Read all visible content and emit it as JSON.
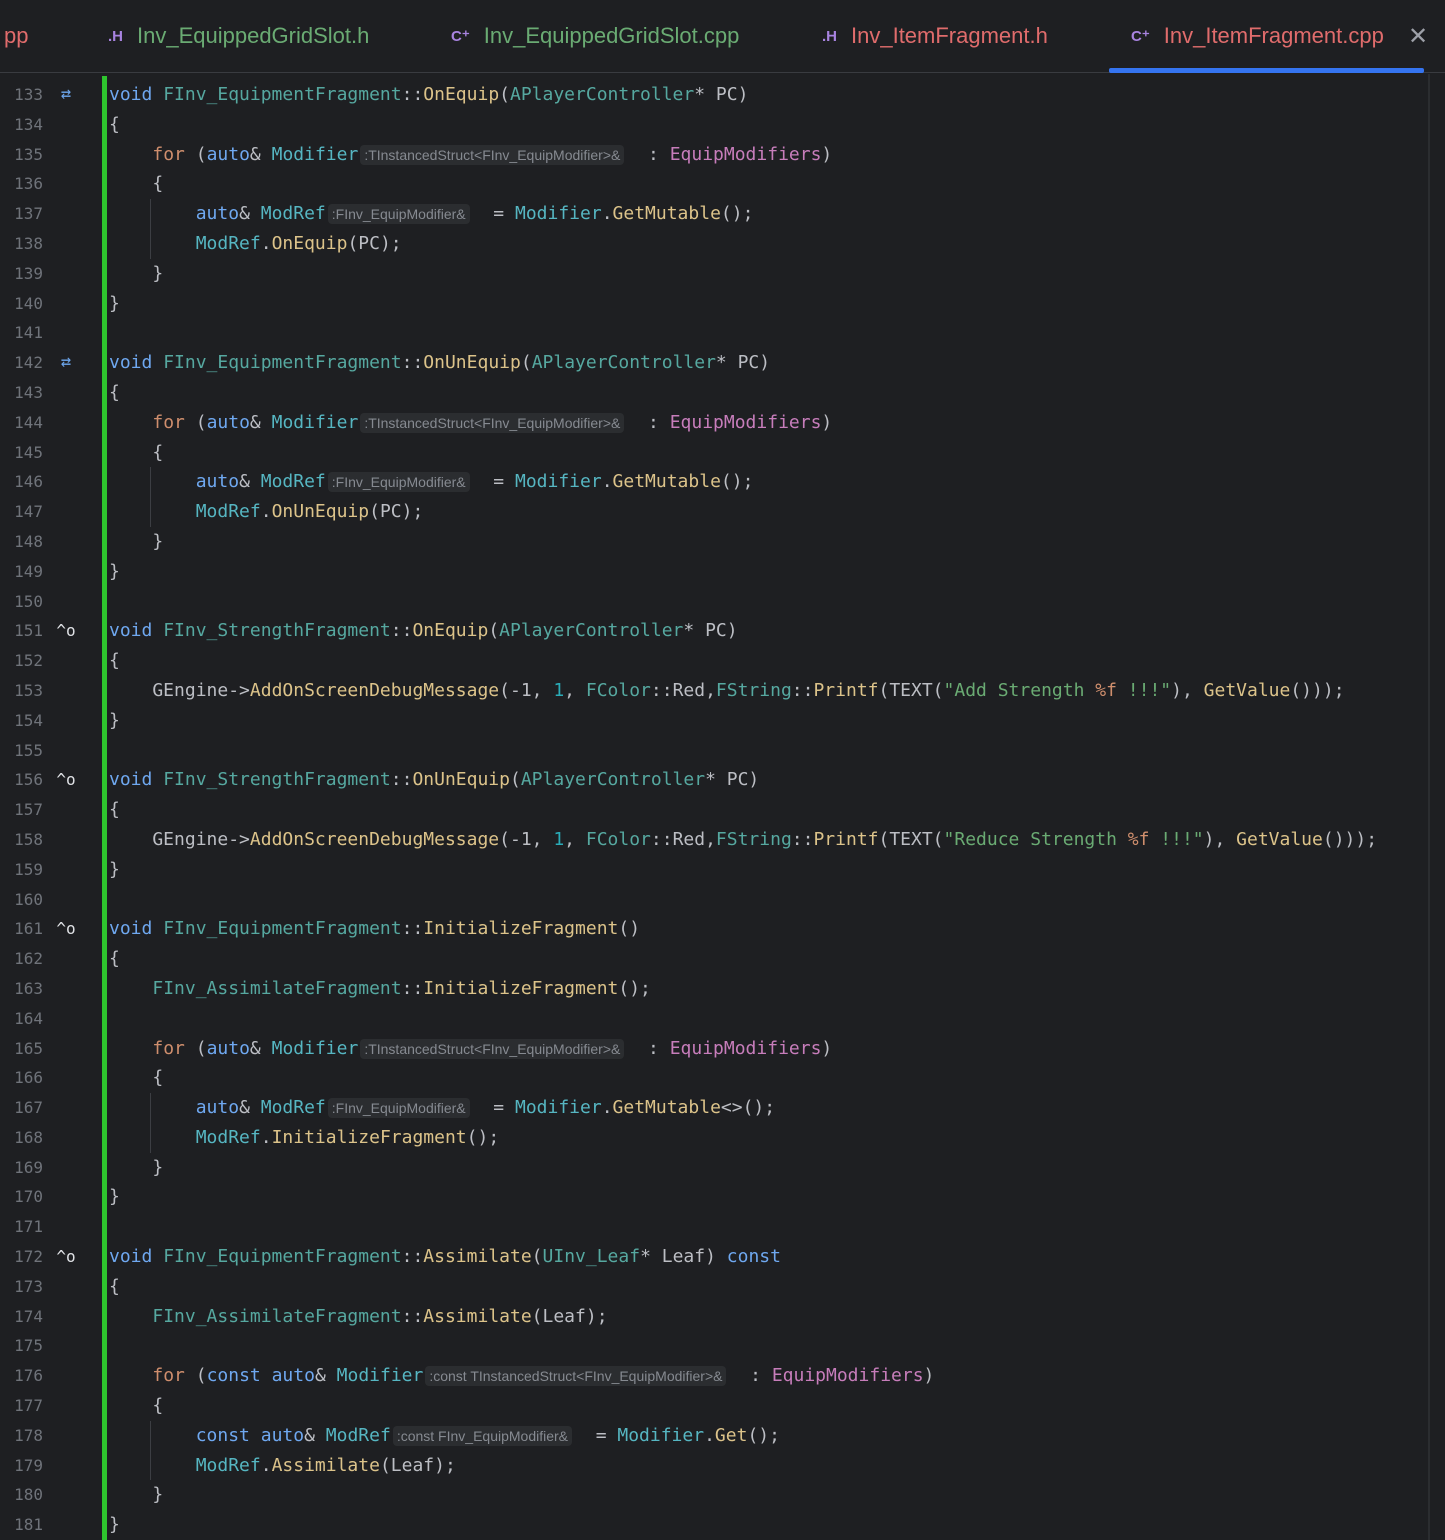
{
  "tabs": [
    {
      "type": "",
      "name": "pp",
      "color": "#e06c6c",
      "left": 0
    },
    {
      "type": ".H",
      "name": "Inv_EquippedGridSlot.h",
      "color": "#6aab73",
      "typecolor": "#a883e0"
    },
    {
      "type": "C⁺",
      "name": "Inv_EquippedGridSlot.cpp",
      "color": "#6aab73",
      "typecolor": "#a883e0"
    },
    {
      "type": ".H",
      "name": "Inv_ItemFragment.h",
      "color": "#e06c6c",
      "typecolor": "#a883e0"
    },
    {
      "type": "C⁺",
      "name": "Inv_ItemFragment.cpp",
      "color": "#e06c6c",
      "typecolor": "#a883e0",
      "active": true
    }
  ],
  "close_label": "✕",
  "lines": [
    {
      "n": "133",
      "icon": "⇄",
      "code": [
        [
          "k2",
          "void "
        ],
        [
          "cls",
          "FInv_EquipmentFragment"
        ],
        [
          "",
          "::"
        ],
        [
          "fn",
          "OnEquip"
        ],
        [
          "",
          "("
        ],
        [
          "cls",
          "APlayerController"
        ],
        [
          "",
          "* PC)"
        ]
      ]
    },
    {
      "n": "134",
      "code": [
        [
          "",
          "{"
        ]
      ]
    },
    {
      "n": "135",
      "code": [
        [
          "",
          "    "
        ],
        [
          "kw",
          "for "
        ],
        [
          "",
          "("
        ],
        [
          "k2",
          "auto"
        ],
        [
          "",
          "& "
        ],
        [
          "fn2",
          "Modifier"
        ],
        [
          "hint",
          ":TInstancedStruct<FInv_EquipModifier>&"
        ],
        [
          "",
          "  : "
        ],
        [
          "mem",
          "EquipModifiers"
        ],
        [
          "",
          ")"
        ]
      ]
    },
    {
      "n": "136",
      "code": [
        [
          "",
          "    {"
        ]
      ]
    },
    {
      "n": "137",
      "guide": true,
      "code": [
        [
          "",
          "        "
        ],
        [
          "k2",
          "auto"
        ],
        [
          "",
          "& "
        ],
        [
          "fn2",
          "ModRef"
        ],
        [
          "hint",
          ":FInv_EquipModifier&"
        ],
        [
          "",
          "  = "
        ],
        [
          "fn2",
          "Modifier"
        ],
        [
          "",
          "."
        ],
        [
          "fn",
          "GetMutable"
        ],
        [
          "",
          "();"
        ]
      ]
    },
    {
      "n": "138",
      "guide": true,
      "code": [
        [
          "",
          "        "
        ],
        [
          "fn2",
          "ModRef"
        ],
        [
          "",
          "."
        ],
        [
          "fn",
          "OnEquip"
        ],
        [
          "",
          "(PC);"
        ]
      ]
    },
    {
      "n": "139",
      "code": [
        [
          "",
          "    }"
        ]
      ]
    },
    {
      "n": "140",
      "code": [
        [
          "",
          "}"
        ]
      ]
    },
    {
      "n": "141",
      "code": []
    },
    {
      "n": "142",
      "icon": "⇄",
      "code": [
        [
          "k2",
          "void "
        ],
        [
          "cls",
          "FInv_EquipmentFragment"
        ],
        [
          "",
          "::"
        ],
        [
          "fn",
          "OnUnEquip"
        ],
        [
          "",
          "("
        ],
        [
          "cls",
          "APlayerController"
        ],
        [
          "",
          "* PC)"
        ]
      ]
    },
    {
      "n": "143",
      "code": [
        [
          "",
          "{"
        ]
      ]
    },
    {
      "n": "144",
      "code": [
        [
          "",
          "    "
        ],
        [
          "kw",
          "for "
        ],
        [
          "",
          "("
        ],
        [
          "k2",
          "auto"
        ],
        [
          "",
          "& "
        ],
        [
          "fn2",
          "Modifier"
        ],
        [
          "hint",
          ":TInstancedStruct<FInv_EquipModifier>&"
        ],
        [
          "",
          "  : "
        ],
        [
          "mem",
          "EquipModifiers"
        ],
        [
          "",
          ")"
        ]
      ]
    },
    {
      "n": "145",
      "code": [
        [
          "",
          "    {"
        ]
      ]
    },
    {
      "n": "146",
      "guide": true,
      "code": [
        [
          "",
          "        "
        ],
        [
          "k2",
          "auto"
        ],
        [
          "",
          "& "
        ],
        [
          "fn2",
          "ModRef"
        ],
        [
          "hint",
          ":FInv_EquipModifier&"
        ],
        [
          "",
          "  = "
        ],
        [
          "fn2",
          "Modifier"
        ],
        [
          "",
          "."
        ],
        [
          "fn",
          "GetMutable"
        ],
        [
          "",
          "();"
        ]
      ]
    },
    {
      "n": "147",
      "guide": true,
      "code": [
        [
          "",
          "        "
        ],
        [
          "fn2",
          "ModRef"
        ],
        [
          "",
          "."
        ],
        [
          "fn",
          "OnUnEquip"
        ],
        [
          "",
          "(PC);"
        ]
      ]
    },
    {
      "n": "148",
      "code": [
        [
          "",
          "    }"
        ]
      ]
    },
    {
      "n": "149",
      "code": [
        [
          "",
          "}"
        ]
      ]
    },
    {
      "n": "150",
      "code": []
    },
    {
      "n": "151",
      "icon": "^o",
      "impl": true,
      "code": [
        [
          "k2",
          "void "
        ],
        [
          "cls",
          "FInv_StrengthFragment"
        ],
        [
          "",
          "::"
        ],
        [
          "fn",
          "OnEquip"
        ],
        [
          "",
          "("
        ],
        [
          "cls",
          "APlayerController"
        ],
        [
          "",
          "* PC)"
        ]
      ]
    },
    {
      "n": "152",
      "code": [
        [
          "",
          "{"
        ]
      ]
    },
    {
      "n": "153",
      "code": [
        [
          "",
          "    GEngine->"
        ],
        [
          "fn",
          "AddOnScreenDebugMessage"
        ],
        [
          "",
          "(-1, "
        ],
        [
          "num",
          "1"
        ],
        [
          "",
          ", "
        ],
        [
          "cls",
          "FColor"
        ],
        [
          "",
          "::Red,"
        ],
        [
          "cls",
          "FString"
        ],
        [
          "",
          "::"
        ],
        [
          "fn",
          "Printf"
        ],
        [
          "",
          "(TEXT("
        ],
        [
          "str",
          "\"Add Strength "
        ],
        [
          "fmt",
          "%f"
        ],
        [
          "str",
          " !!!\""
        ],
        [
          "",
          "), "
        ],
        [
          "fn",
          "GetValue"
        ],
        [
          "",
          "()));"
        ]
      ]
    },
    {
      "n": "154",
      "code": [
        [
          "",
          "}"
        ]
      ]
    },
    {
      "n": "155",
      "code": []
    },
    {
      "n": "156",
      "icon": "^o",
      "impl": true,
      "code": [
        [
          "k2",
          "void "
        ],
        [
          "cls",
          "FInv_StrengthFragment"
        ],
        [
          "",
          "::"
        ],
        [
          "fn",
          "OnUnEquip"
        ],
        [
          "",
          "("
        ],
        [
          "cls",
          "APlayerController"
        ],
        [
          "",
          "* PC)"
        ]
      ]
    },
    {
      "n": "157",
      "code": [
        [
          "",
          "{"
        ]
      ]
    },
    {
      "n": "158",
      "code": [
        [
          "",
          "    GEngine->"
        ],
        [
          "fn",
          "AddOnScreenDebugMessage"
        ],
        [
          "",
          "(-1, "
        ],
        [
          "num",
          "1"
        ],
        [
          "",
          ", "
        ],
        [
          "cls",
          "FColor"
        ],
        [
          "",
          "::Red,"
        ],
        [
          "cls",
          "FString"
        ],
        [
          "",
          "::"
        ],
        [
          "fn",
          "Printf"
        ],
        [
          "",
          "(TEXT("
        ],
        [
          "str",
          "\"Reduce Strength "
        ],
        [
          "fmt",
          "%f"
        ],
        [
          "str",
          " !!!\""
        ],
        [
          "",
          "), "
        ],
        [
          "fn",
          "GetValue"
        ],
        [
          "",
          "()));"
        ]
      ]
    },
    {
      "n": "159",
      "code": [
        [
          "",
          "}"
        ]
      ]
    },
    {
      "n": "160",
      "code": []
    },
    {
      "n": "161",
      "icon": "^o",
      "impl": true,
      "code": [
        [
          "k2",
          "void "
        ],
        [
          "cls",
          "FInv_EquipmentFragment"
        ],
        [
          "",
          "::"
        ],
        [
          "fn",
          "InitializeFragment"
        ],
        [
          "",
          "()"
        ]
      ]
    },
    {
      "n": "162",
      "code": [
        [
          "",
          "{"
        ]
      ]
    },
    {
      "n": "163",
      "code": [
        [
          "",
          "    "
        ],
        [
          "cls",
          "FInv_AssimilateFragment"
        ],
        [
          "",
          "::"
        ],
        [
          "fn",
          "InitializeFragment"
        ],
        [
          "",
          "();"
        ]
      ]
    },
    {
      "n": "164",
      "code": []
    },
    {
      "n": "165",
      "code": [
        [
          "",
          "    "
        ],
        [
          "kw",
          "for "
        ],
        [
          "",
          "("
        ],
        [
          "k2",
          "auto"
        ],
        [
          "",
          "& "
        ],
        [
          "fn2",
          "Modifier"
        ],
        [
          "hint",
          ":TInstancedStruct<FInv_EquipModifier>&"
        ],
        [
          "",
          "  : "
        ],
        [
          "mem",
          "EquipModifiers"
        ],
        [
          "",
          ")"
        ]
      ]
    },
    {
      "n": "166",
      "code": [
        [
          "",
          "    {"
        ]
      ]
    },
    {
      "n": "167",
      "guide": true,
      "code": [
        [
          "",
          "        "
        ],
        [
          "k2",
          "auto"
        ],
        [
          "",
          "& "
        ],
        [
          "fn2",
          "ModRef"
        ],
        [
          "hint",
          ":FInv_EquipModifier&"
        ],
        [
          "",
          "  = "
        ],
        [
          "fn2",
          "Modifier"
        ],
        [
          "",
          "."
        ],
        [
          "fn",
          "GetMutable"
        ],
        [
          "",
          "<>();"
        ]
      ]
    },
    {
      "n": "168",
      "guide": true,
      "code": [
        [
          "",
          "        "
        ],
        [
          "fn2",
          "ModRef"
        ],
        [
          "",
          "."
        ],
        [
          "fn",
          "InitializeFragment"
        ],
        [
          "",
          "();"
        ]
      ]
    },
    {
      "n": "169",
      "code": [
        [
          "",
          "    }"
        ]
      ]
    },
    {
      "n": "170",
      "code": [
        [
          "",
          "}"
        ]
      ]
    },
    {
      "n": "171",
      "code": []
    },
    {
      "n": "172",
      "icon": "^o",
      "impl": true,
      "code": [
        [
          "k2",
          "void "
        ],
        [
          "cls",
          "FInv_EquipmentFragment"
        ],
        [
          "",
          "::"
        ],
        [
          "fn",
          "Assimilate"
        ],
        [
          "",
          "("
        ],
        [
          "cls",
          "UInv_Leaf"
        ],
        [
          "",
          "* Leaf) "
        ],
        [
          "k2",
          "const"
        ]
      ]
    },
    {
      "n": "173",
      "code": [
        [
          "",
          "{"
        ]
      ]
    },
    {
      "n": "174",
      "code": [
        [
          "",
          "    "
        ],
        [
          "cls",
          "FInv_AssimilateFragment"
        ],
        [
          "",
          "::"
        ],
        [
          "fn",
          "Assimilate"
        ],
        [
          "",
          "(Leaf);"
        ]
      ]
    },
    {
      "n": "175",
      "code": []
    },
    {
      "n": "176",
      "code": [
        [
          "",
          "    "
        ],
        [
          "kw",
          "for "
        ],
        [
          "",
          "("
        ],
        [
          "k2",
          "const "
        ],
        [
          "k2",
          "auto"
        ],
        [
          "",
          "& "
        ],
        [
          "fn2",
          "Modifier"
        ],
        [
          "hint",
          ":const TInstancedStruct<FInv_EquipModifier>&"
        ],
        [
          "",
          "  : "
        ],
        [
          "mem",
          "EquipModifiers"
        ],
        [
          "",
          ")"
        ]
      ]
    },
    {
      "n": "177",
      "code": [
        [
          "",
          "    {"
        ]
      ]
    },
    {
      "n": "178",
      "guide": true,
      "code": [
        [
          "",
          "        "
        ],
        [
          "k2",
          "const "
        ],
        [
          "k2",
          "auto"
        ],
        [
          "",
          "& "
        ],
        [
          "fn2",
          "ModRef"
        ],
        [
          "hint",
          ":const FInv_EquipModifier&"
        ],
        [
          "",
          "  = "
        ],
        [
          "fn2",
          "Modifier"
        ],
        [
          "",
          "."
        ],
        [
          "fn",
          "Get"
        ],
        [
          "",
          "();"
        ]
      ]
    },
    {
      "n": "179",
      "guide": true,
      "code": [
        [
          "",
          "        "
        ],
        [
          "fn2",
          "ModRef"
        ],
        [
          "",
          "."
        ],
        [
          "fn",
          "Assimilate"
        ],
        [
          "",
          "(Leaf);"
        ]
      ]
    },
    {
      "n": "180",
      "code": [
        [
          "",
          "    }"
        ]
      ]
    },
    {
      "n": "181",
      "code": [
        [
          "",
          "}"
        ]
      ]
    }
  ]
}
